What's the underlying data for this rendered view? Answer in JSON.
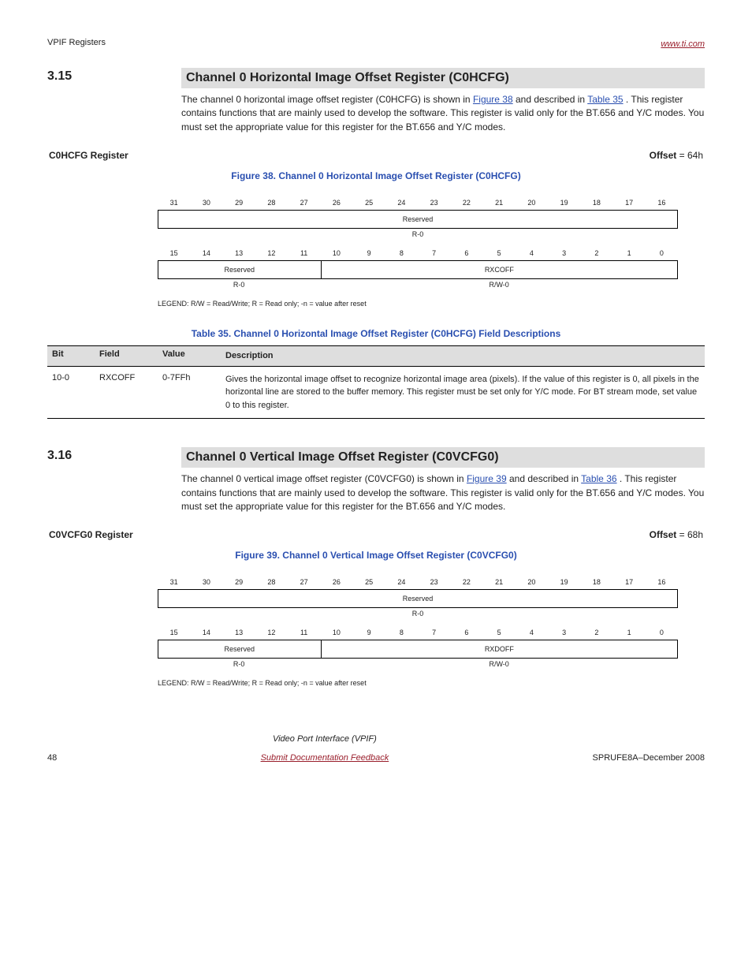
{
  "header": {
    "left": "VPIF Registers",
    "right_link": "www.ti.com"
  },
  "section1": {
    "number": "3.15",
    "title": "Channel 0 Horizontal Image Offset Register (C0HCFG)",
    "desc_prefix": "The channel 0 horizontal image offset register (C0HCFG) is shown in ",
    "fig_ref": "Figure 38",
    "desc_mid": " and described in ",
    "tbl_ref": "Table 35",
    "desc_suffix": ". This register contains functions that are mainly used to develop the software. This register is valid only for the BT.656 and Y/C modes. You must set the appropriate value for this register for the BT.656 and Y/C modes.",
    "reg_label": "C0HCFG Register",
    "offset": "Offset",
    "offsetval": "64h",
    "figure": "Figure 38. Channel 0 Horizontal Image Offset Register (C0HCFG)",
    "bits_high": [
      "31",
      "30",
      "29",
      "28",
      "27",
      "26",
      "25",
      "24",
      "23",
      "22",
      "21",
      "20",
      "19",
      "18",
      "17",
      "16"
    ],
    "bits_low": [
      "15",
      "14",
      "13",
      "12",
      "11",
      "10",
      "9",
      "8",
      "7",
      "6",
      "5",
      "4",
      "3",
      "2",
      "1",
      "0"
    ],
    "field_hi": "Reserved",
    "field_lo_a": "Reserved",
    "field_lo_b": "RXCOFF",
    "acc_hi": "R-0",
    "acc_lo_a": "R-0",
    "acc_lo_b": "R/W-0",
    "legend": "LEGEND: R/W = Read/Write; R = Read only; -n = value after reset",
    "table_caption": "Table 35. Channel 0 Horizontal Image Offset Register (C0HCFG) Field Descriptions",
    "th_bit": "Bit",
    "th_field": "Field",
    "th_value": "Value",
    "th_desc": "Description",
    "row_bit": "10-0",
    "row_field": "RXCOFF",
    "row_val": "0-7FFh",
    "row_desc": "Gives the horizontal image offset to recognize horizontal image area (pixels). If the value of this register is 0, all pixels in the horizontal line are stored to the buffer memory. This register must be set only for Y/C mode. For BT stream mode, set value 0 to this register."
  },
  "section2": {
    "number": "3.16",
    "title": "Channel 0 Vertical Image Offset Register (C0VCFG0)",
    "desc_prefix": "The channel 0 vertical image offset register (C0VCFG0) is shown in ",
    "fig_ref": "Figure 39",
    "desc_mid": " and described in ",
    "tbl_ref": "Table 36",
    "desc_suffix": ". This register contains functions that are mainly used to develop the software. This register is valid only for the BT.656 and Y/C modes. You must set the appropriate value for this register for the BT.656 and Y/C modes.",
    "reg_label": "C0VCFG0 Register",
    "offset": "Offset",
    "offsetval": "68h",
    "figure": "Figure 39. Channel 0 Vertical Image Offset Register (C0VCFG0)",
    "bits_high": [
      "31",
      "30",
      "29",
      "28",
      "27",
      "26",
      "25",
      "24",
      "23",
      "22",
      "21",
      "20",
      "19",
      "18",
      "17",
      "16"
    ],
    "bits_low": [
      "15",
      "14",
      "13",
      "12",
      "11",
      "10",
      "9",
      "8",
      "7",
      "6",
      "5",
      "4",
      "3",
      "2",
      "1",
      "0"
    ],
    "field_hi": "Reserved",
    "field_lo_a": "Reserved",
    "field_lo_b": "RXDOFF",
    "acc_hi": "R-0",
    "acc_lo_a": "R-0",
    "acc_lo_b": "R/W-0",
    "legend": "LEGEND: R/W = Read/Write; R = Read only; -n = value after reset"
  },
  "footer": {
    "page": "48",
    "title": "Video Port Interface (VPIF)",
    "doc": "SPRUFE8A–December 2008",
    "feedback": "Submit Documentation Feedback"
  }
}
